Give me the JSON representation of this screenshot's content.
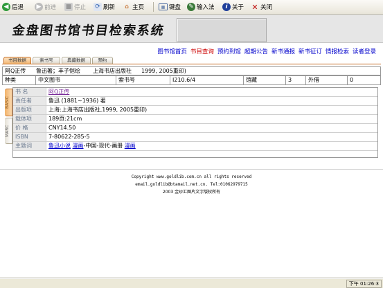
{
  "toolbar": {
    "back": "后退",
    "forward": "前进",
    "stop": "停止",
    "refresh": "刷新",
    "home": "主页",
    "keyboard": "键盘",
    "input_method": "输入法",
    "about": "关于",
    "close": "关闭"
  },
  "banner": {
    "title": "金盘图书馆书目检索系统"
  },
  "nav": {
    "items": [
      "图书馆首页",
      "书目查询",
      "预约到馆",
      "超期公告",
      "新书通报",
      "新书征订",
      "情报检索",
      "读者登录"
    ],
    "active": "书目查询"
  },
  "tabs": [
    "书目数据",
    "索书号",
    "典藏数据",
    "预约"
  ],
  "summary": {
    "title": "阿Q正传",
    "author": "鲁迅著；丰子恺绘",
    "publisher": "上海书店出版社",
    "year": "1999, 2005重印)"
  },
  "info": {
    "type_label": "种类",
    "type_value": "中文图书",
    "callno_label": "索书号",
    "callno_value": "I210.6/4",
    "holdings_label": "馆藏",
    "holdings_value": "3",
    "loaned_label": "外借",
    "loaned_value": "0"
  },
  "vtabs": {
    "basic": "BASIC",
    "marc": "MARC"
  },
  "fields": [
    {
      "label": "书  名",
      "value": "阿Q正传"
    },
    {
      "label": "责任者",
      "value": "鲁迅 (1881~1936) 著"
    },
    {
      "label": "出版项",
      "value": "上海:上海书店出版社,1999, 2005重印)"
    },
    {
      "label": "载体项",
      "value": "189页:21cm"
    },
    {
      "label": "价  格",
      "value": "CNY14.50"
    },
    {
      "label": "ISBN",
      "value": "7-80622-285-5"
    },
    {
      "label": "主题词",
      "subject1": "鲁迅小说",
      "subject2": "漫画",
      "subject_mid": "-中国-现代-画册",
      "subject_sep": " ",
      "subject3": "漫画"
    }
  ],
  "footer": {
    "copyright": "Copyright www.goldlib.com.cn all rights reserved",
    "contact": "email.goldlib@btamail.net.cn. Tel:01062979715",
    "notice": "2003 金纱汇图片文字版权所有"
  },
  "status": {
    "time": "下午 01:26:3"
  }
}
